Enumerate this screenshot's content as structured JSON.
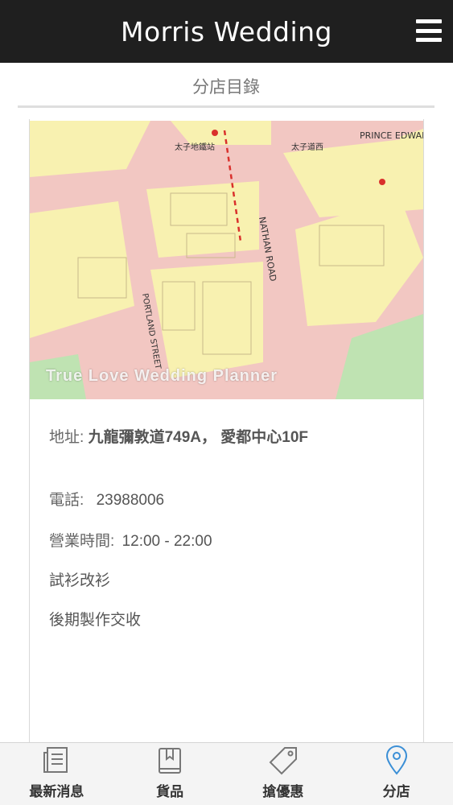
{
  "header": {
    "title": "Morris Wedding",
    "menu_icon": "hamburger-menu-icon"
  },
  "page": {
    "section_title": "分店目錄"
  },
  "store": {
    "map_watermark": "True Love Wedding Planner",
    "map_labels": {
      "prince_edward": "PRINCE EDWARD",
      "nathan_road": "NATHAN ROAD",
      "portland_street": "PORTLAND STREET",
      "prince_edward_cn": "太子道西",
      "mtr": "太子地鐵站"
    },
    "address_label": "地址:",
    "address_value": "九龍彌敦道749A， 愛都中心10F",
    "phone_label": "電話:",
    "phone_value": "23988006",
    "hours_label": "營業時間:",
    "hours_value": "12:00 - 22:00",
    "service_1": "試衫改衫",
    "service_2": "後期製作交收"
  },
  "tabbar": {
    "active_color": "#3b8fd6",
    "tabs": [
      {
        "label": "最新消息",
        "icon": "news-icon"
      },
      {
        "label": "貨品",
        "icon": "book-icon"
      },
      {
        "label": "搶優惠",
        "icon": "tag-icon"
      },
      {
        "label": "分店",
        "icon": "location-pin-icon"
      }
    ]
  }
}
